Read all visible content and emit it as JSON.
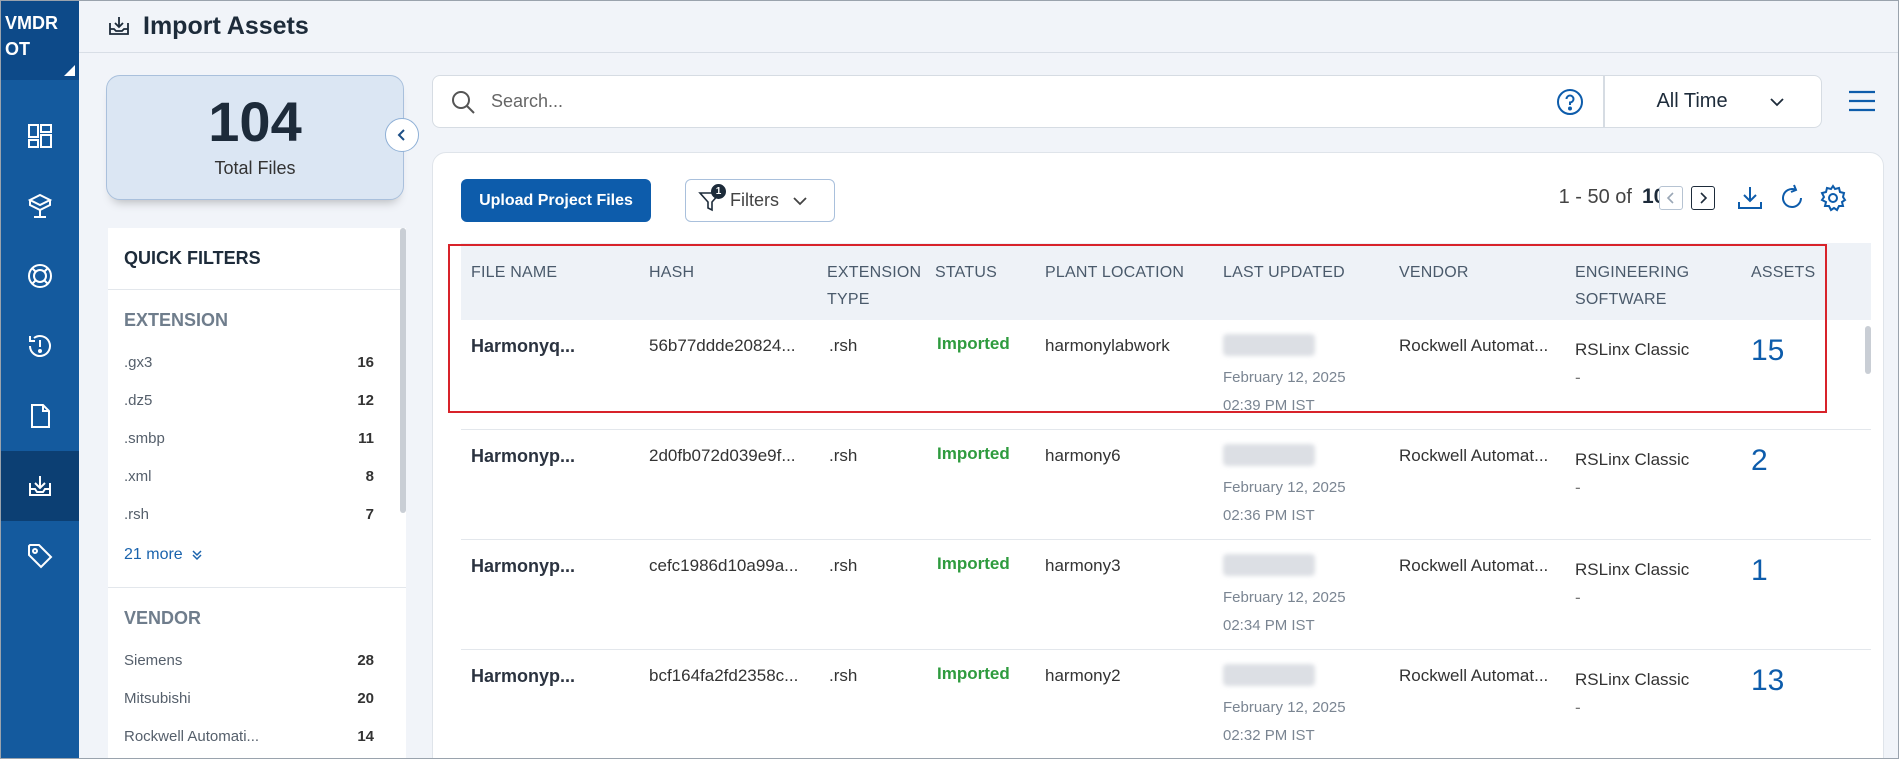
{
  "brand": {
    "line1": "VMDR",
    "line2": "OT"
  },
  "header": {
    "title": "Import Assets"
  },
  "summary": {
    "total_files": "104",
    "total_files_label": "Total Files"
  },
  "quick_filters": {
    "title": "QUICK FILTERS",
    "extension": {
      "heading": "EXTENSION",
      "items": [
        {
          "label": ".gx3",
          "count": "16"
        },
        {
          "label": ".dz5",
          "count": "12"
        },
        {
          "label": ".smbp",
          "count": "11"
        },
        {
          "label": ".xml",
          "count": "8"
        },
        {
          "label": ".rsh",
          "count": "7"
        }
      ],
      "more_label": "21 more"
    },
    "vendor": {
      "heading": "VENDOR",
      "items": [
        {
          "label": "Siemens",
          "count": "28"
        },
        {
          "label": "Mitsubishi",
          "count": "20"
        },
        {
          "label": "Rockwell Automati...",
          "count": "14"
        }
      ]
    }
  },
  "search": {
    "placeholder": "Search...",
    "value": ""
  },
  "time_filter": {
    "selected": "All Time"
  },
  "toolbar": {
    "upload_label": "Upload Project Files",
    "filters_label": "Filters",
    "filters_badge": "1",
    "pager_range": "1 - 50 of",
    "pager_total": "104"
  },
  "table": {
    "columns": {
      "file_name": "FILE NAME",
      "hash": "HASH",
      "extension_1": "EXTENSION",
      "extension_2": "TYPE",
      "status": "STATUS",
      "plant_location": "PLANT LOCATION",
      "last_updated": "LAST UPDATED",
      "vendor": "VENDOR",
      "engineering_1": "ENGINEERING",
      "engineering_2": "SOFTWARE",
      "assets": "ASSETS"
    },
    "rows": [
      {
        "file_name": "Harmonyq...",
        "hash": "56b77ddde20824...",
        "ext": ".rsh",
        "status": "Imported",
        "plant": "harmonylabwork",
        "date": "February 12, 2025",
        "time": "02:39 PM IST",
        "vendor": "Rockwell Automat...",
        "eng": "RSLinx Classic",
        "eng_sub": "-",
        "assets": "15"
      },
      {
        "file_name": "Harmonyp...",
        "hash": "2d0fb072d039e9f...",
        "ext": ".rsh",
        "status": "Imported",
        "plant": "harmony6",
        "date": "February 12, 2025",
        "time": "02:36 PM IST",
        "vendor": "Rockwell Automat...",
        "eng": "RSLinx Classic",
        "eng_sub": "-",
        "assets": "2"
      },
      {
        "file_name": "Harmonyp...",
        "hash": "cefc1986d10a99a...",
        "ext": ".rsh",
        "status": "Imported",
        "plant": "harmony3",
        "date": "February 12, 2025",
        "time": "02:34 PM IST",
        "vendor": "Rockwell Automat...",
        "eng": "RSLinx Classic",
        "eng_sub": "-",
        "assets": "1"
      },
      {
        "file_name": "Harmonyp...",
        "hash": "bcf164fa2fd2358c...",
        "ext": ".rsh",
        "status": "Imported",
        "plant": "harmony2",
        "date": "February 12, 2025",
        "time": "02:32 PM IST",
        "vendor": "Rockwell Automat...",
        "eng": "RSLinx Classic",
        "eng_sub": "-",
        "assets": "13"
      }
    ]
  },
  "colors": {
    "brand": "#145a9e",
    "primary": "#0d5cab",
    "status_imported": "#2e9b3e",
    "highlight": "#d8232a"
  }
}
